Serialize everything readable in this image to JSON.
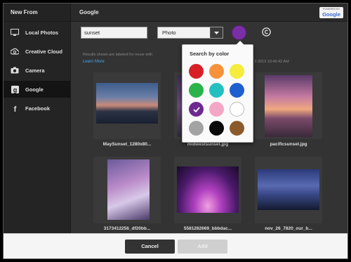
{
  "sidebar": {
    "title": "New From",
    "items": [
      {
        "label": "Local Photos",
        "icon": "monitor-icon"
      },
      {
        "label": "Creative Cloud",
        "icon": "creative-cloud-icon"
      },
      {
        "label": "Camera",
        "icon": "camera-icon"
      },
      {
        "label": "Google",
        "icon": "google-icon",
        "active": true
      },
      {
        "label": "Facebook",
        "icon": "facebook-icon"
      }
    ]
  },
  "main": {
    "title": "Google",
    "badge": {
      "powered_by": "POWERED BY",
      "wordmark": "Google"
    },
    "search": {
      "value": "sunset"
    },
    "type_select": {
      "value": "Photo"
    },
    "selected_color": "#7b2fa6",
    "info_text": "Results shown are labeled for reuse with",
    "info_text_2": "at Thu Jan 3 2013 10:46:42 AM",
    "learn_more": "Learn More"
  },
  "color_popup": {
    "title": "Search by color",
    "swatches": [
      {
        "name": "red",
        "color": "#d81f26"
      },
      {
        "name": "orange",
        "color": "#f7923a"
      },
      {
        "name": "yellow",
        "color": "#f5ec3b"
      },
      {
        "name": "green",
        "color": "#2ab34a"
      },
      {
        "name": "teal",
        "color": "#26bfbf"
      },
      {
        "name": "blue",
        "color": "#1f5fcf"
      },
      {
        "name": "purple",
        "color": "#6d2a91",
        "selected": true
      },
      {
        "name": "pink",
        "color": "#f4a6c6"
      },
      {
        "name": "white",
        "color": "#ffffff"
      },
      {
        "name": "gray",
        "color": "#a3a3a3"
      },
      {
        "name": "black",
        "color": "#0a0a0a"
      },
      {
        "name": "brown",
        "color": "#8b5a2b"
      }
    ]
  },
  "results": [
    {
      "caption": "MaySunset_1280x80..."
    },
    {
      "caption": "midwestsunset.jpg"
    },
    {
      "caption": "pacificsunset.jpg"
    },
    {
      "caption": "3173412256_df20bb..."
    },
    {
      "caption": "5581282669_bbbdac..."
    },
    {
      "caption": "nov_26_7820_our_b..."
    }
  ],
  "footer": {
    "cancel_label": "Cancel",
    "add_label": "Add"
  }
}
